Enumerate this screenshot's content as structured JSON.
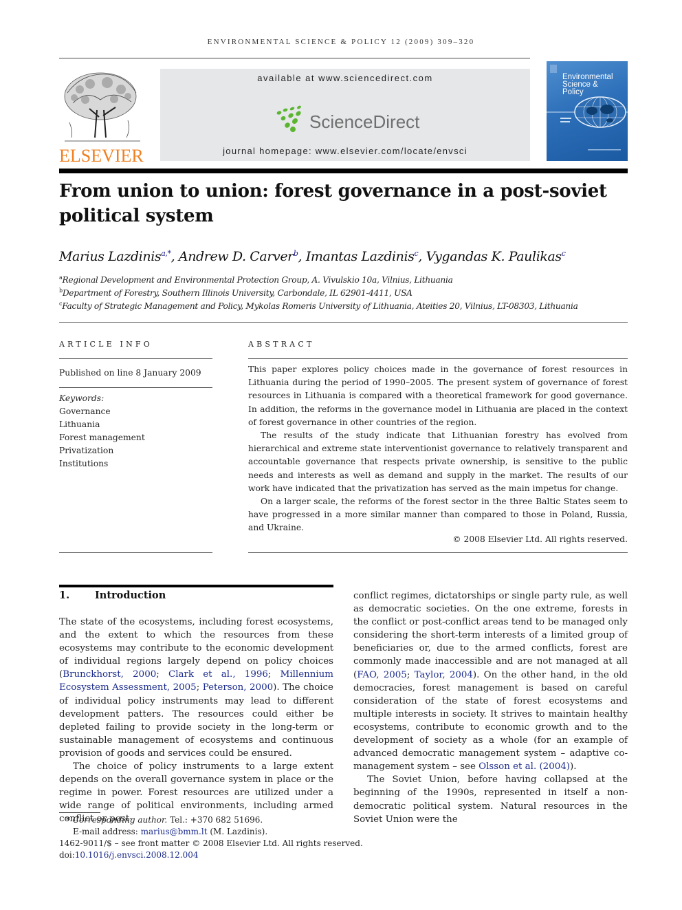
{
  "running_head": "ENVIRONMENTAL SCIENCE & POLICY 12 (2009) 309–320",
  "banner": {
    "publisher_logo_text": "ELSEVIER",
    "available_at": "available at www.sciencedirect.com",
    "sciencedirect_logo_text": "ScienceDirect",
    "journal_homepage": "journal homepage: www.elsevier.com/locate/envsci",
    "cover_title_lines": [
      "Environmental",
      "Science &",
      "Policy"
    ],
    "colors": {
      "elsevier_orange": "#f07f1f",
      "sd_green": "#5cb531",
      "sd_gray": "#6e706f",
      "banner_bg": "#e6e7e9",
      "cover_blue": "#2d6fb9"
    }
  },
  "article": {
    "title_line1": "From union to union: forest governance in a post-soviet",
    "title_line2": "political system",
    "authors": [
      {
        "name": "Marius Lazdinis",
        "sup": "a,*"
      },
      {
        "name": "Andrew D. Carver",
        "sup": "b"
      },
      {
        "name": "Imantas Lazdinis",
        "sup": "c"
      },
      {
        "name": "Vygandas K. Paulikas",
        "sup": "c"
      }
    ],
    "affiliations": [
      {
        "key": "a",
        "text": "Regional Development and Environmental Protection Group, A. Vivulskio 10a, Vilnius, Lithuania"
      },
      {
        "key": "b",
        "text": "Department of Forestry, Southern Illinois University, Carbondale, IL 62901-4411, USA"
      },
      {
        "key": "c",
        "text": "Faculty of Strategic Management and Policy, Mykolas Romeris University of Lithuania, Ateities 20, Vilnius, LT-08303, Lithuania"
      }
    ]
  },
  "article_info": {
    "heading": "ARTICLE INFO",
    "published": "Published on line 8 January 2009",
    "keywords_label": "Keywords:",
    "keywords": [
      "Governance",
      "Lithuania",
      "Forest management",
      "Privatization",
      "Institutions"
    ]
  },
  "abstract": {
    "heading": "ABSTRACT",
    "paragraphs": [
      "This paper explores policy choices made in the governance of forest resources in Lithuania during the period of 1990–2005. The present system of governance of forest resources in Lithuania is compared with a theoretical framework for good governance. In addition, the reforms in the governance model in Lithuania are placed in the context of forest governance in other countries of the region.",
      "The results of the study indicate that Lithuanian forestry has evolved from hierarchical and extreme state interventionist governance to relatively transparent and accountable governance that respects private ownership, is sensitive to the public needs and interests as well as demand and supply in the market. The results of our work have indicated that the privatization has served as the main impetus for change.",
      "On a larger scale, the reforms of the forest sector in the three Baltic States seem to have progressed in a more similar manner than compared to those in Poland, Russia, and Ukraine."
    ],
    "copyright": "© 2008 Elsevier Ltd. All rights reserved."
  },
  "introduction": {
    "number": "1.",
    "heading": "Introduction",
    "left_p1_a": "The state of the ecosystems, including forest ecosystems, and the extent to which the resources from these ecosystems may contribute to the economic development of individual regions largely depend on policy choices (",
    "left_p1_refs": [
      "Brunckhorst, 2000",
      "Clark et al., 1996",
      "Millennium Ecosystem Assessment, 2005",
      "Peterson, 2000"
    ],
    "left_p1_b": "). The choice of individual policy instruments may lead to different development patters. The resources could either be depleted failing to provide society in the long-term or sustainable management of ecosystems and continuous provision of goods and services could be ensured.",
    "left_p2": "The choice of policy instruments to a large extent depends on the overall governance system in place or the regime in power. Forest resources are utilized under a wide range of political environments, including armed conflict or post-",
    "right_p1_a": "conflict regimes, dictatorships or single party rule, as well as democratic societies. On the one extreme, forests in the conflict or post-conflict areas tend to be managed only considering the short-term interests of a limited group of beneficiaries or, due to the armed conflicts, forest are commonly made inaccessible and are not managed at all (",
    "right_p1_refs": [
      "FAO, 2005",
      "Taylor, 2004"
    ],
    "right_p1_b": "). On the other hand, in the old democracies, forest management is based on careful consideration of the state of forest ecosystems and multiple interests in society. It strives to maintain healthy ecosystems, contribute to economic growth and to the development of society as a whole (for an example of advanced democratic management system – adaptive co-management system – see ",
    "right_p1_ref2": "Olsson et al. (2004)",
    "right_p1_c": ").",
    "right_p2": "The Soviet Union, before having collapsed at the beginning of the 1990s, represented in itself a non-democratic political system. Natural resources in the Soviet Union were the"
  },
  "footnotes": {
    "star": "*",
    "corresponding_label": "Corresponding author.",
    "tel": "Tel.: +370 682 51696.",
    "email_label": "E-mail address:",
    "email": "marius@bmm.lt",
    "email_owner": "(M. Lazdinis).",
    "issn_line": "1462-9011/$ – see front matter © 2008 Elsevier Ltd. All rights reserved.",
    "doi_label": "doi:",
    "doi": "10.1016/j.envsci.2008.12.004"
  }
}
